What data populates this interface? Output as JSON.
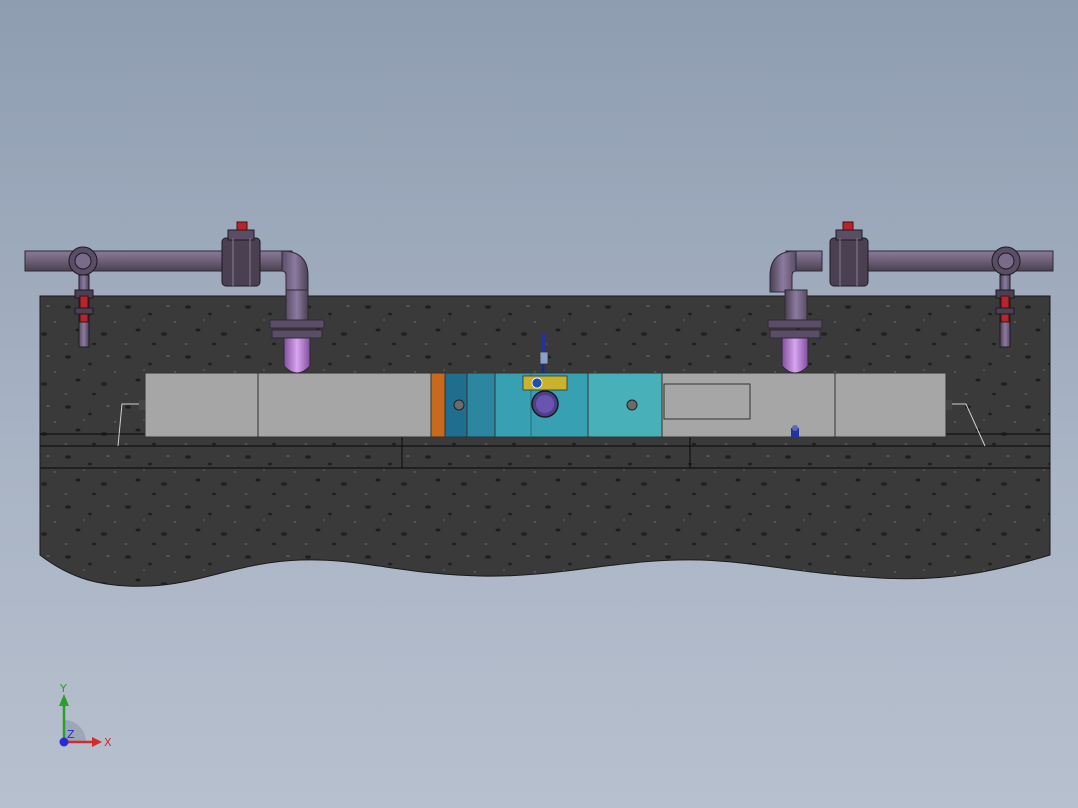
{
  "view": {
    "background_top": "#8f9db1",
    "background_bottom": "#b7c0ce"
  },
  "concrete": {
    "color": "#3a3a3a",
    "speckle": "#1f1f1f",
    "speckle_light": "#5a5a5a"
  },
  "pipes": {
    "color": "#6f627a",
    "highlight": "#b07ac8",
    "valve_handle": "#b3262b"
  },
  "tank": {
    "segments": [
      {
        "name": "inlet-chamber",
        "color": "#a6a6a6"
      },
      {
        "name": "orange-baffle",
        "color": "#c76a1d"
      },
      {
        "name": "teal-chamber-1",
        "color": "#1f6d8f"
      },
      {
        "name": "teal-chamber-2",
        "color": "#2b86a0"
      },
      {
        "name": "teal-chamber-3",
        "color": "#37a0b2"
      },
      {
        "name": "teal-chamber-4",
        "color": "#48b0b8"
      },
      {
        "name": "outlet-chamber",
        "color": "#a6a6a6"
      }
    ]
  },
  "triad": {
    "x_label": "X",
    "y_label": "Y",
    "z_label": "Z",
    "x_color": "#d42a2a",
    "y_color": "#2aa02a",
    "z_color": "#2a2ad4"
  }
}
